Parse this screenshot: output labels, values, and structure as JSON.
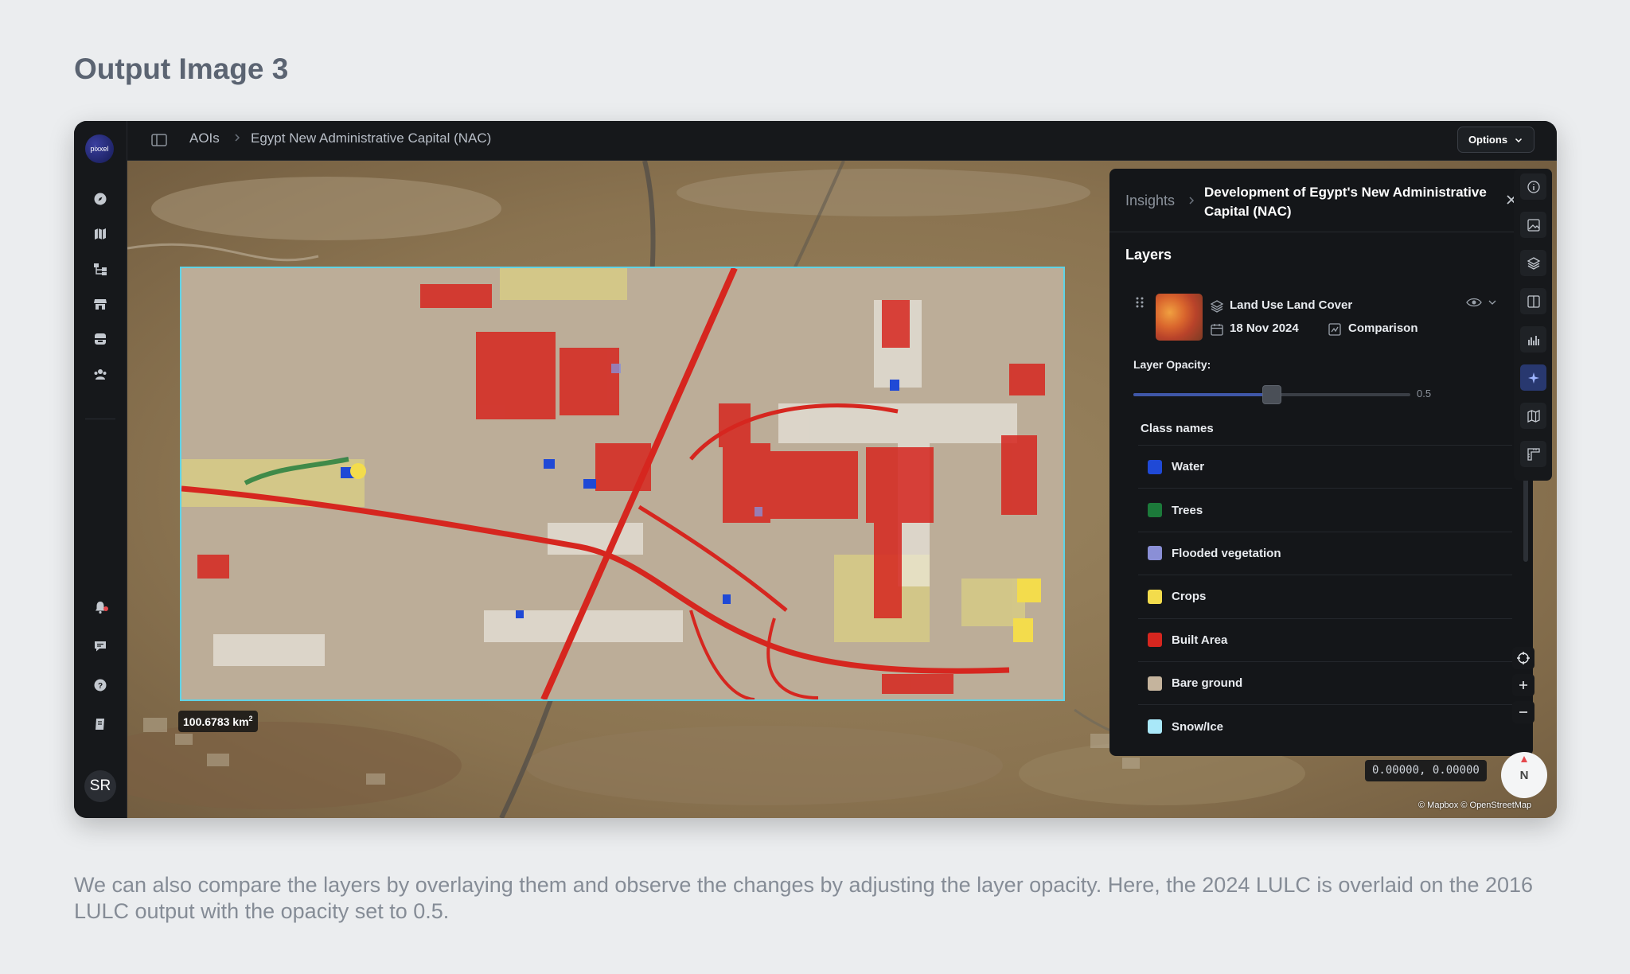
{
  "heading": "Output Image 3",
  "caption": "We can also compare the layers by overlaying them and observe the changes by adjusting the layer opacity. Here, the 2024 LULC is overlaid on the 2016 LULC output with the opacity set to 0.5.",
  "app": {
    "logo_text": "pixxel",
    "avatar_initials": "SR",
    "breadcrumb": {
      "root": "AOIs",
      "current": "Egypt New Administrative Capital (NAC)"
    },
    "options_label": "Options"
  },
  "map": {
    "area_value": "100.6783 km",
    "area_unit_sup": "2",
    "coordinates": "0.00000, 0.00000",
    "attribution": "© Mapbox © OpenStreetMap",
    "compass_label": "N"
  },
  "insights": {
    "crumb": "Insights",
    "title": "Development of Egypt's New Administrative Capital (NAC)",
    "layers_heading": "Layers",
    "layer": {
      "name": "Land Use Land Cover",
      "date": "18 Nov 2024",
      "mode": "Comparison"
    },
    "opacity_label": "Layer Opacity:",
    "opacity_value": "0.5",
    "opacity": 0.5,
    "class_names_heading": "Class names",
    "classes": [
      {
        "label": "Water",
        "color": "#1f49d6"
      },
      {
        "label": "Trees",
        "color": "#1c7a3a"
      },
      {
        "label": "Flooded vegetation",
        "color": "#8a8fd6"
      },
      {
        "label": "Crops",
        "color": "#f3dc4c"
      },
      {
        "label": "Built Area",
        "color": "#d6261f"
      },
      {
        "label": "Bare ground",
        "color": "#c5b49d"
      },
      {
        "label": "Snow/Ice",
        "color": "#a9e8f9"
      }
    ]
  }
}
